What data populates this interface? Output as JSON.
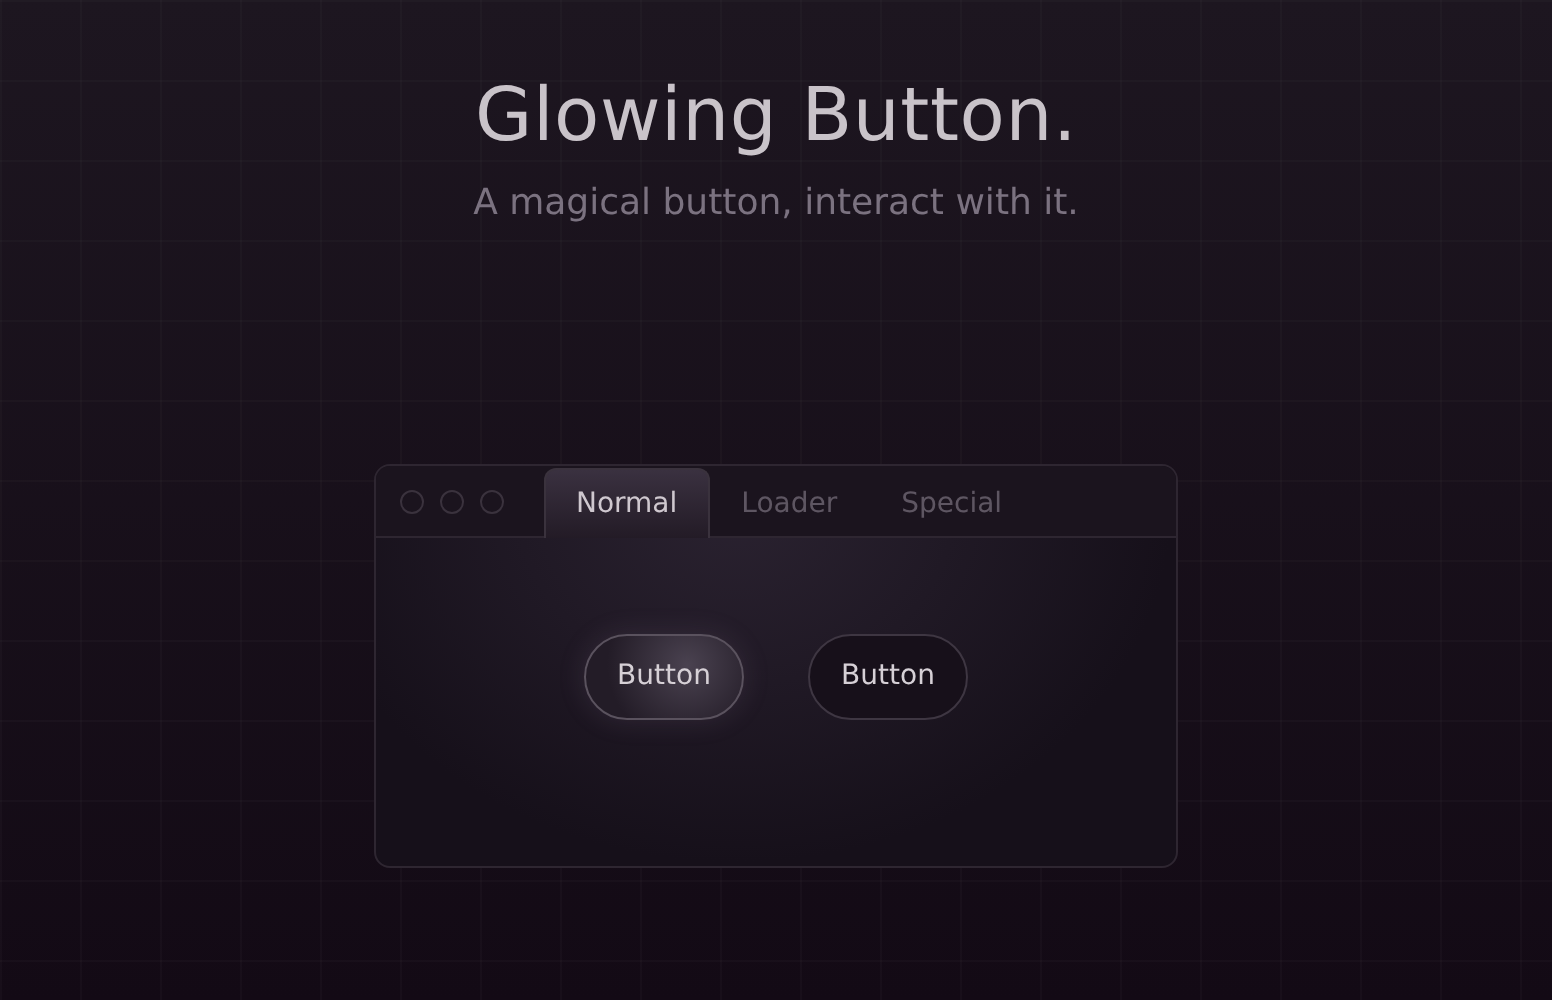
{
  "header": {
    "title": "Glowing Button.",
    "subtitle": "A magical button, interact with it."
  },
  "tabs": [
    {
      "label": "Normal",
      "selected": true
    },
    {
      "label": "Loader",
      "selected": false
    },
    {
      "label": "Special",
      "selected": false
    }
  ],
  "buttons": [
    {
      "label": "Button",
      "glow": true
    },
    {
      "label": "Button",
      "glow": false
    }
  ]
}
